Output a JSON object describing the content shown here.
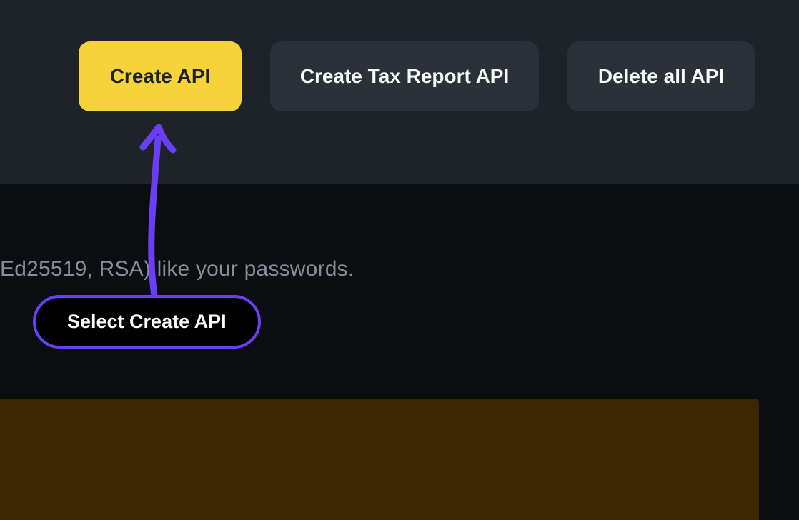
{
  "buttons": {
    "create_api": "Create API",
    "create_tax_report_api": "Create Tax Report API",
    "delete_all_api": "Delete all API"
  },
  "body_fragment": "Ed25519, RSA) like your passwords.",
  "annotation": {
    "label": "Select Create API"
  },
  "colors": {
    "accent_yellow": "#f7d33a",
    "annotation_purple": "#6b3ef5",
    "panel_dark": "#1e2329",
    "background": "#0b0e11",
    "notice_bg": "#3c2601"
  }
}
